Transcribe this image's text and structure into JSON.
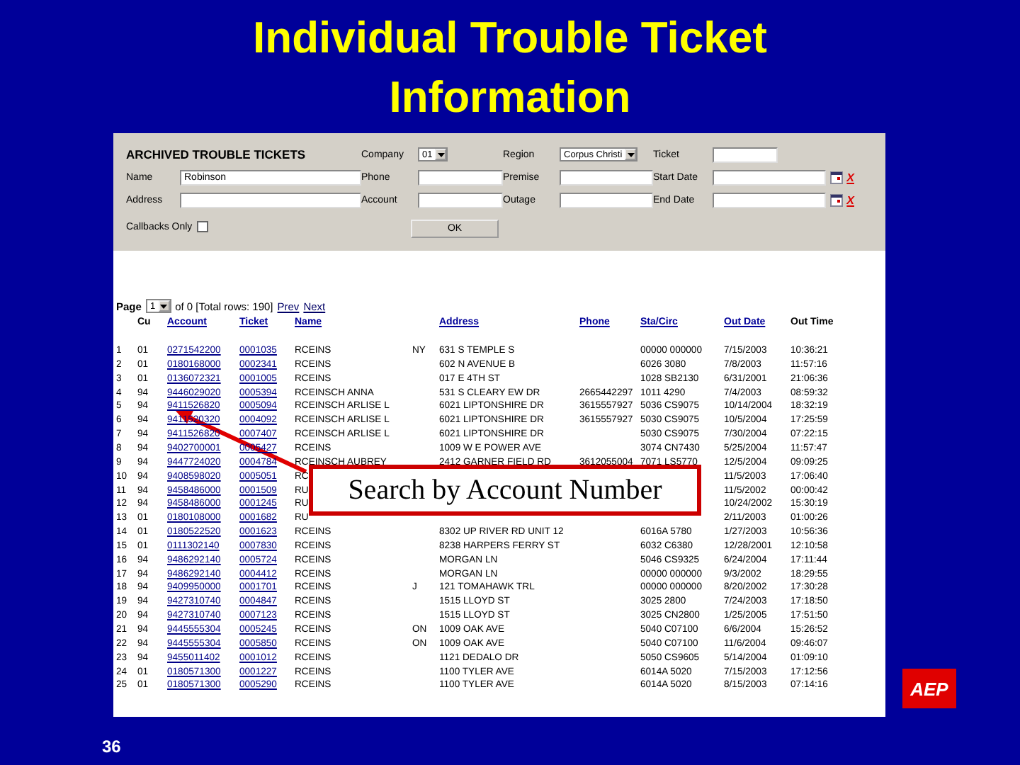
{
  "title_lines": [
    "Individual Trouble Ticket",
    "Information"
  ],
  "form": {
    "rows": [
      [
        {
          "kind": "heading",
          "label": "ARCHIVED TROUBLE TICKETS"
        },
        {
          "kind": "select",
          "label": "Company",
          "value": "01"
        },
        {
          "kind": "select",
          "label": "Region",
          "value": "Corpus Christi"
        },
        {
          "kind": "input",
          "label": "Ticket"
        }
      ],
      [
        {
          "kind": "input",
          "label": "Name",
          "value": "Robinson"
        },
        {
          "kind": "input",
          "label": "Phone"
        },
        {
          "kind": "input",
          "label": "Premise"
        },
        {
          "kind": "date",
          "label": "Start Date",
          "clear": "X"
        }
      ],
      [
        {
          "kind": "input",
          "label": "Address"
        },
        {
          "kind": "input",
          "label": "Account"
        },
        {
          "kind": "input",
          "label": "Outage"
        },
        {
          "kind": "date",
          "label": "End Date",
          "clear": "X"
        }
      ]
    ],
    "callbacks": {
      "label": "Callbacks Only",
      "checked": false
    },
    "ok_button": "OK"
  },
  "pager": {
    "label": "Page",
    "page": "1",
    "info": "of 0 [Total rows: 190]",
    "prev": "Prev",
    "next": "Next"
  },
  "table": {
    "columns": [
      null,
      {
        "label": "Cu",
        "link": false
      },
      {
        "label": "Account",
        "link": true
      },
      {
        "label": "Ticket",
        "link": true
      },
      {
        "label": "Name",
        "link": true
      },
      null,
      {
        "label": "Address",
        "link": true
      },
      {
        "label": "Phone",
        "link": true
      },
      {
        "label": "Sta/Circ",
        "link": true
      },
      {
        "label": "Out Date",
        "link": true
      },
      {
        "label": "Out Time",
        "link": false
      }
    ],
    "rows": [
      [
        "1",
        "01",
        "0271542200",
        "0001035",
        "RCEINS",
        "NY",
        "631 S TEMPLE S",
        "",
        "00000 000000",
        "7/15/2003",
        "10:36:21"
      ],
      [
        "2",
        "01",
        "0180168000",
        "0002341",
        "RCEINS",
        "",
        "602 N AVENUE B",
        "",
        "6026 3080",
        "7/8/2003",
        "11:57:16"
      ],
      [
        "3",
        "01",
        "0136072321",
        "0001005",
        "RCEINS",
        "",
        "017 E 4TH ST",
        "",
        "1028 SB2130",
        "6/31/2001",
        "21:06:36"
      ],
      [
        "4",
        "94",
        "9446029020",
        "0005394",
        "RCEINSCH ANNA",
        "",
        "531 S CLEARY EW DR",
        "2665442297",
        "1011 4290",
        "7/4/2003",
        "08:59:32"
      ],
      [
        "5",
        "94",
        "9411526820",
        "0005094",
        "RCEINSCH ARLISE L",
        "",
        "6021 LIPTONSHIRE DR",
        "3615557927",
        "5036 CS9075",
        "10/14/2004",
        "18:32:19"
      ],
      [
        "6",
        "94",
        "9411520320",
        "0004092",
        "RCEINSCH ARLISE L",
        "",
        "6021 LIPTONSHIRE DR",
        "3615557927",
        "5030 CS9075",
        "10/5/2004",
        "17:25:59"
      ],
      [
        "7",
        "94",
        "9411526820",
        "0007407",
        "RCEINSCH ARLISE L",
        "",
        "6021 LIPTONSHIRE DR",
        "",
        "5030 CS9075",
        "7/30/2004",
        "07:22:15"
      ],
      [
        "8",
        "94",
        "9402700001",
        "0005427",
        "RCEINS",
        "",
        "1009 W E POWER AVE",
        "",
        "3074 CN7430",
        "5/25/2004",
        "11:57:47"
      ],
      [
        "9",
        "94",
        "9447724020",
        "0004784",
        "RCEINSCH AUBREY",
        "",
        "2412 GARNER FIELD RD",
        "3612055004",
        "7071 LS5770",
        "12/5/2004",
        "09:09:25"
      ],
      [
        "10",
        "94",
        "9408598020",
        "0005051",
        "RC",
        "",
        "",
        "",
        "",
        "11/5/2003",
        "17:06:40"
      ],
      [
        "11",
        "94",
        "9458486000",
        "0001509",
        "RU",
        "",
        "",
        "",
        "",
        "11/5/2002",
        "00:00:42"
      ],
      [
        "12",
        "94",
        "9458486000",
        "0001245",
        "RU",
        "",
        "",
        "",
        "",
        "10/24/2002",
        "15:30:19"
      ],
      [
        "13",
        "01",
        "0180108000",
        "0001682",
        "RU",
        "",
        "",
        "",
        "",
        "2/11/2003",
        "01:00:26"
      ],
      [
        "14",
        "01",
        "0180522520",
        "0001623",
        "RCEINS",
        "",
        "8302 UP RIVER RD UNIT 12",
        "",
        "6016A 5780",
        "1/27/2003",
        "10:56:36"
      ],
      [
        "15",
        "01",
        "0111302140",
        "0007830",
        "RCEINS",
        "",
        "8238 HARPERS FERRY ST",
        "",
        "6032 C6380",
        "12/28/2001",
        "12:10:58"
      ],
      [
        "16",
        "94",
        "9486292140",
        "0005724",
        "RCEINS",
        "",
        "MORGAN LN",
        "",
        "5046 CS9325",
        "6/24/2004",
        "17:11:44"
      ],
      [
        "17",
        "94",
        "9486292140",
        "0004412",
        "RCEINS",
        "",
        "MORGAN LN",
        "",
        "00000 000000",
        "9/3/2002",
        "18:29:55"
      ],
      [
        "18",
        "94",
        "9409950000",
        "0001701",
        "RCEINS",
        "J",
        "121 TOMAHAWK TRL",
        "",
        "00000 000000",
        "8/20/2002",
        "17:30:28"
      ],
      [
        "19",
        "94",
        "9427310740",
        "0004847",
        "RCEINS",
        "",
        "1515 LLOYD ST",
        "",
        "3025 2800",
        "7/24/2003",
        "17:18:50"
      ],
      [
        "20",
        "94",
        "9427310740",
        "0007123",
        "RCEINS",
        "",
        "1515 LLOYD ST",
        "",
        "3025 CN2800",
        "1/25/2005",
        "17:51:50"
      ],
      [
        "21",
        "94",
        "9445555304",
        "0005245",
        "RCEINS",
        "ON",
        "1009 OAK AVE",
        "",
        "5040 C07100",
        "6/6/2004",
        "15:26:52"
      ],
      [
        "22",
        "94",
        "9445555304",
        "0005850",
        "RCEINS",
        "ON",
        "1009 OAK AVE",
        "",
        "5040 C07100",
        "11/6/2004",
        "09:46:07"
      ],
      [
        "23",
        "94",
        "9455011402",
        "0001012",
        "RCEINS",
        "",
        "1121 DEDALO DR",
        "",
        "5050 CS9605",
        "5/14/2004",
        "01:09:10"
      ],
      [
        "24",
        "01",
        "0180571300",
        "0001227",
        "RCEINS",
        "",
        "1100 TYLER AVE",
        "",
        "6014A 5020",
        "7/15/2003",
        "17:12:56"
      ],
      [
        "25",
        "01",
        "0180571300",
        "0005290",
        "RCEINS",
        "",
        "1100 TYLER AVE",
        "",
        "6014A 5020",
        "8/15/2003",
        "07:14:16"
      ]
    ]
  },
  "callout": "Search by Account Number",
  "slide_number": "36",
  "logo": "AEP"
}
